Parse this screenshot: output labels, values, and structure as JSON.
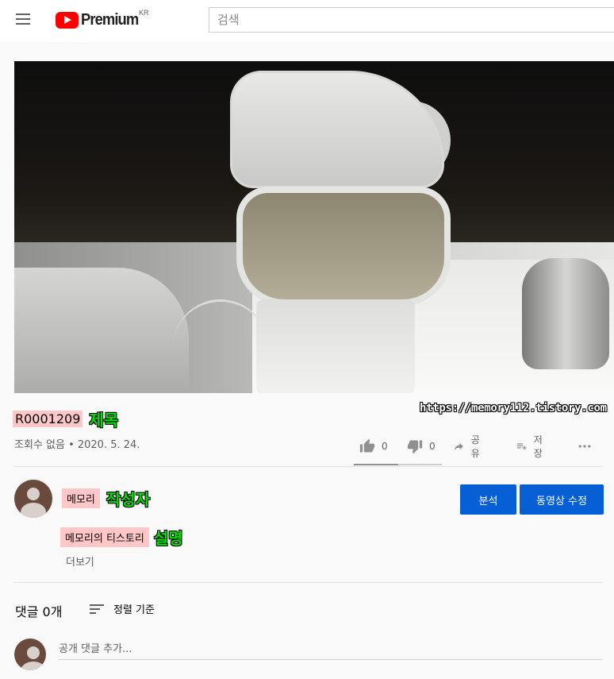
{
  "header": {
    "logo_text": "Premium",
    "country_code": "KR",
    "search_placeholder": "검색"
  },
  "video": {
    "title": "R0001209",
    "title_annotation": "제목",
    "watermark": "https://memory112.tistory.com",
    "meta": "조회수 없음 • 2020. 5. 24."
  },
  "actions": {
    "like_count": "0",
    "dislike_count": "0",
    "share_label": "공유",
    "save_label": "저장",
    "more_icon": "more-horizontal-icon",
    "sentiment_like_fraction": 0.5
  },
  "channel": {
    "name": "메모리",
    "name_annotation": "작성자",
    "analytics_button": "분석",
    "edit_button": "동영상 수정",
    "description": "메모리의 티스토리",
    "description_annotation": "설명",
    "show_more": "더보기"
  },
  "comments": {
    "count_label": "댓글 0개",
    "sort_label": "정렬 기준",
    "add_placeholder": "공개 댓글 추가..."
  },
  "colors": {
    "brand_red": "#ff0000",
    "button_blue": "#065fd4",
    "highlight_pink": "#ffc7c7",
    "annotation_green": "#00e000"
  }
}
